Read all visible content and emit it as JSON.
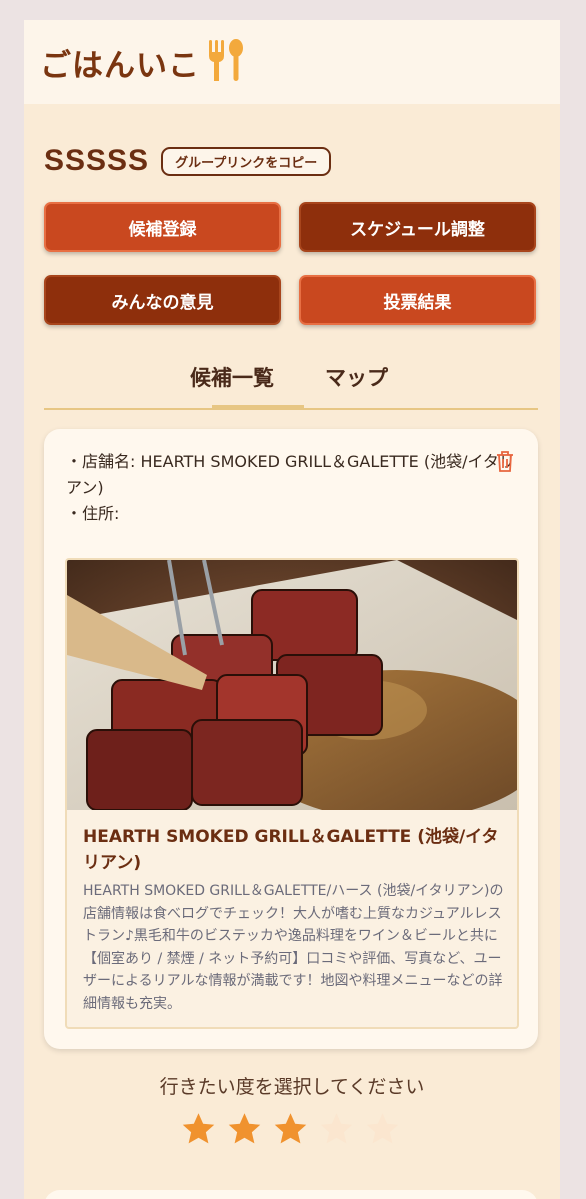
{
  "app": {
    "logo_text": "ごはんいこ",
    "logo_icon": "fork-spoon-icon"
  },
  "group": {
    "name": "SSSSS",
    "copy_link_label": "グループリンクをコピー"
  },
  "actions": {
    "register_label": "候補登録",
    "schedule_label": "スケジュール調整",
    "opinions_label": "みんなの意見",
    "results_label": "投票結果"
  },
  "tabs": [
    {
      "label": "候補一覧",
      "active": true
    },
    {
      "label": "マップ",
      "active": false
    }
  ],
  "candidate": {
    "store_line": "・店舗名: HEARTH SMOKED GRILL＆GALETTE (池袋/イタリアン)",
    "address_line": "・住所:",
    "delete_icon": "trash-icon",
    "preview": {
      "image_subject": "grilled wagyu steak cubes",
      "title": "HEARTH SMOKED GRILL＆GALETTE (池袋/イタリアン)",
      "description": "HEARTH SMOKED GRILL＆GALETTE/ハース (池袋/イタリアン)の店舗情報は食べログでチェック！大人が嗜む上質なカジュアルレストラン♪黒毛和牛のビステッカや逸品料理をワイン＆ビールと共に 【個室あり / 禁煙 / ネット予約可】口コミや評価、写真など、ユーザーによるリアルな情報が満載です！地図や料理メニューなどの詳細情報も充実。"
    }
  },
  "rating": {
    "prompt": "行きたい度を選択してください",
    "value": 3,
    "max": 5
  },
  "colors": {
    "background": "#faebd6",
    "accent_dark": "#8e2f0c",
    "accent_light": "#c9481f",
    "star_active": "#f0922e",
    "star_inactive": "#fbe6cf",
    "tab_underline": "#e7c684"
  }
}
